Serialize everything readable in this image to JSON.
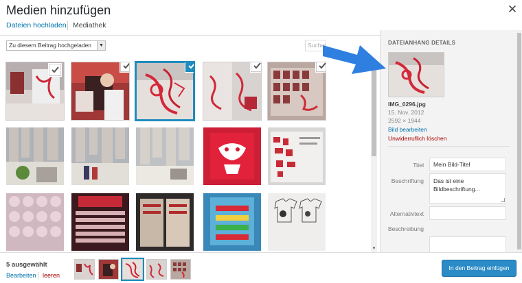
{
  "title": "Medien hinzufügen",
  "close_icon": "close-icon",
  "menu": {
    "upload": "Dateien hochladen",
    "library": "Mediathek"
  },
  "filter": {
    "selected": "Zu diesem Beitrag hochgeladen"
  },
  "search": {
    "placeholder": "Suchen"
  },
  "details": {
    "heading": "DATEIANHANG DETAILS",
    "filename": "IMG_0296.jpg",
    "date": "15. Nov. 2012",
    "dimensions": "2592 × 1944",
    "edit_link": "Bild bearbeiten",
    "delete_link": "Unwiderruflich löschen",
    "fields": {
      "title_label": "Titel",
      "title_value": "Mein Bild-Titel",
      "caption_label": "Beschriftung",
      "caption_value": "Das ist eine Bildbeschriftung...",
      "alt_label": "Alternativtext",
      "alt_value": "",
      "description_label": "Beschreibung",
      "description_value": ""
    }
  },
  "selection": {
    "count_text": "5 ausgewählt",
    "edit": "Bearbeiten",
    "clear": "leeren"
  },
  "insert_button": "In den Beitrag einfügen",
  "colors": {
    "accent": "#1e8cbe",
    "link": "#0073aa",
    "danger": "#aa0000",
    "arrow": "#2f7fe0"
  }
}
